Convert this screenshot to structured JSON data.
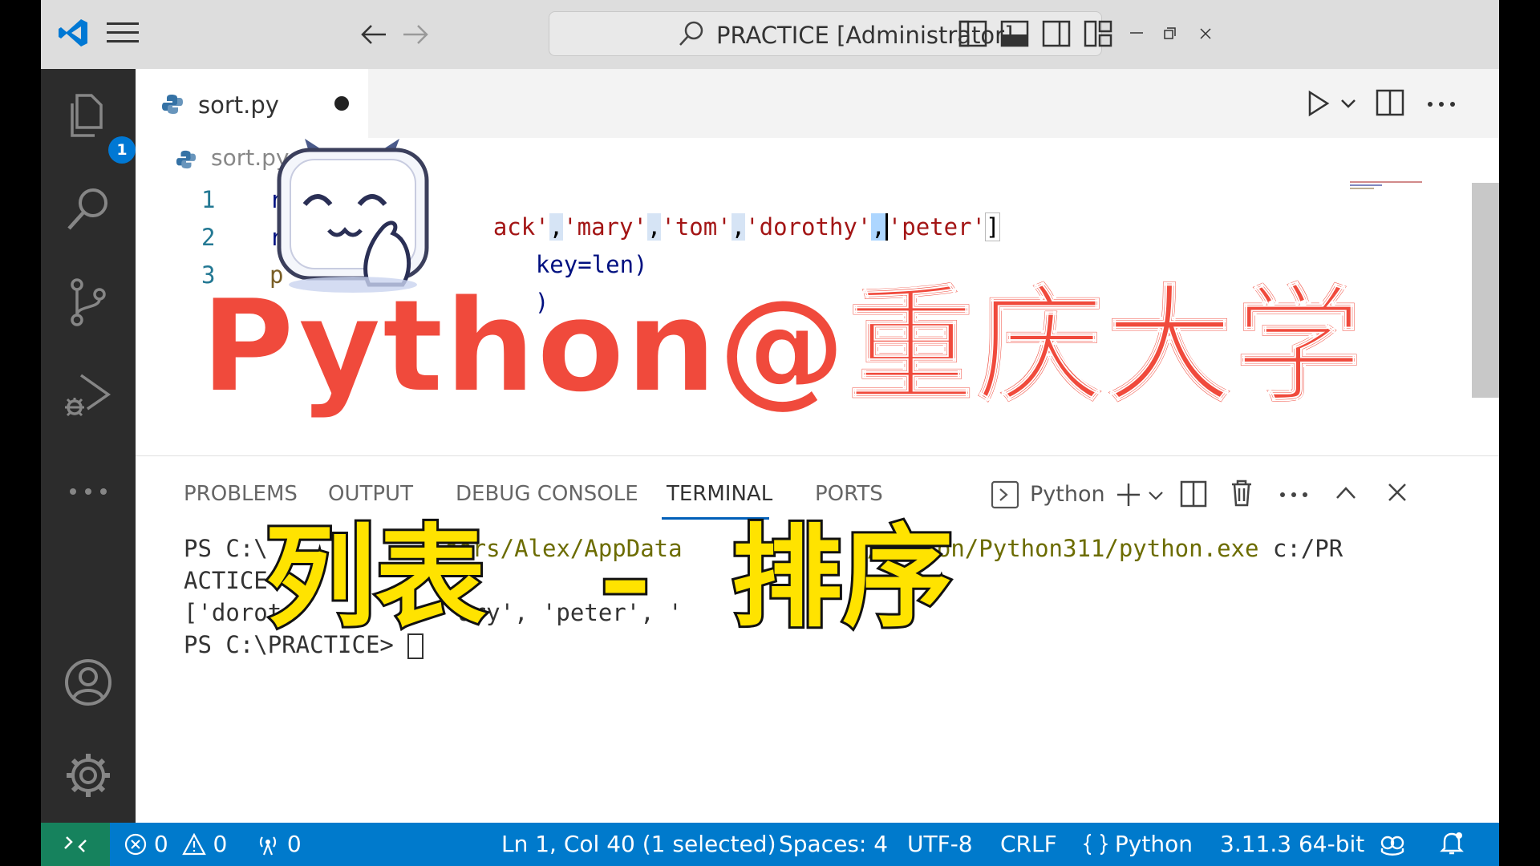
{
  "title_bar": {
    "search_text": "PRACTICE [Administrator]"
  },
  "activity_bar": {
    "explorer_badge": "1"
  },
  "tab": {
    "label": "sort.py"
  },
  "breadcrumb": "sort.py",
  "editor": {
    "line_numbers": [
      "1",
      "2",
      "3"
    ],
    "line1_visible": [
      "ack'",
      ",",
      "'mary'",
      ",",
      "'tom'",
      ",",
      "'dorothy'",
      ",",
      "'peter'",
      "]"
    ],
    "line2_visible": "key=len)",
    "line3_visible": ")"
  },
  "panel": {
    "tabs": [
      "PROBLEMS",
      "OUTPUT",
      "DEBUG CONSOLE",
      "TERMINAL",
      "PORTS"
    ],
    "active_tab": "TERMINAL",
    "terminal_type": "Python",
    "terminal_lines": {
      "l1_a": "PS C:\\",
      "l1_b": "sers/Alex/AppData",
      "l1_c": "/Python/Python311/python.exe",
      "l1_d": " c:/PR",
      "l2": "ACTICE",
      "l3_a": "['dorot",
      "l3_b": "ary', 'peter', '",
      "l4": "PS C:\\PRACTICE> "
    }
  },
  "status_bar": {
    "errors": "0",
    "warnings": "0",
    "ports": "0",
    "position": "Ln 1, Col 40 (1 selected)",
    "spaces": "Spaces: 4",
    "encoding": "UTF-8",
    "eol": "CRLF",
    "language": "Python",
    "interpreter": "3.11.3 64-bit"
  },
  "overlay": {
    "title": "Python@重庆大学",
    "left_text": "列表",
    "dash": "–",
    "right_text": "排序"
  },
  "colors": {
    "accent": "#007acc",
    "remote": "#16825d",
    "overlay_red": "#f04a3c",
    "overlay_yellow": "#ffe300"
  }
}
